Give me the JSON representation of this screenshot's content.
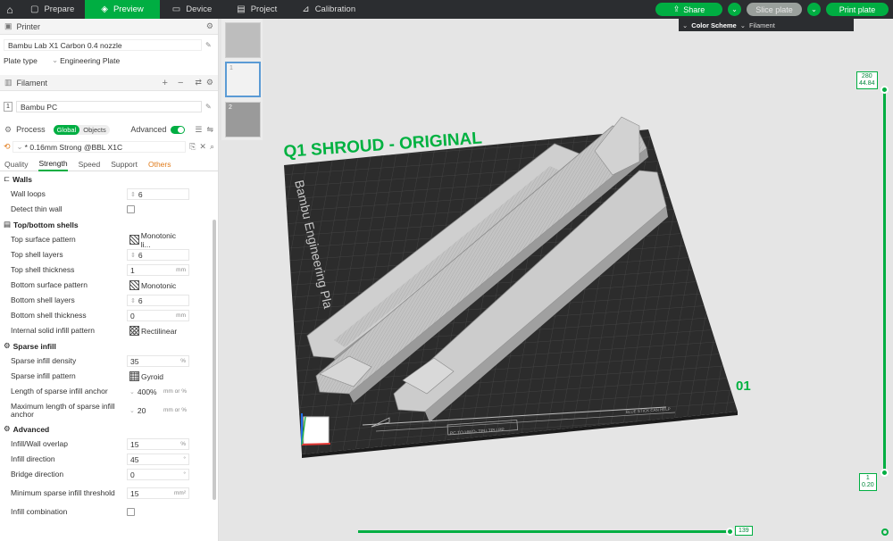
{
  "topbar": {
    "tabs": [
      {
        "label": "Prepare",
        "active": false
      },
      {
        "label": "Preview",
        "active": true
      },
      {
        "label": "Device",
        "active": false
      },
      {
        "label": "Project",
        "active": false
      },
      {
        "label": "Calibration",
        "active": false
      }
    ],
    "share": "Share",
    "slice_plate": "Slice plate",
    "print_plate": "Print plate"
  },
  "printer": {
    "title": "Printer",
    "name": "Bambu Lab X1 Carbon 0.4 nozzle",
    "plate_type_label": "Plate type",
    "plate_type": "Engineering Plate"
  },
  "filament": {
    "title": "Filament",
    "slot": "1",
    "name": "Bambu PC"
  },
  "process": {
    "title": "Process",
    "scope": [
      "Global",
      "Objects"
    ],
    "advanced_label": "Advanced",
    "preset": "* 0.16mm Strong @BBL X1C",
    "tabs": [
      "Quality",
      "Strength",
      "Speed",
      "Support",
      "Others"
    ],
    "active_tab": "Strength"
  },
  "settings": {
    "walls": {
      "title": "Walls",
      "wall_loops_label": "Wall loops",
      "wall_loops": "6",
      "detect_thin_wall_label": "Detect thin wall"
    },
    "shells": {
      "title": "Top/bottom shells",
      "top_pattern_label": "Top surface pattern",
      "top_pattern": "Monotonic li...",
      "top_layers_label": "Top shell layers",
      "top_layers": "6",
      "top_thickness_label": "Top shell thickness",
      "top_thickness": "1",
      "top_thickness_unit": "mm",
      "bottom_pattern_label": "Bottom surface pattern",
      "bottom_pattern": "Monotonic",
      "bottom_layers_label": "Bottom shell layers",
      "bottom_layers": "6",
      "bottom_thickness_label": "Bottom shell thickness",
      "bottom_thickness": "0",
      "bottom_thickness_unit": "mm",
      "internal_pattern_label": "Internal solid infill pattern",
      "internal_pattern": "Rectilinear"
    },
    "sparse": {
      "title": "Sparse infill",
      "density_label": "Sparse infill density",
      "density": "35",
      "density_unit": "%",
      "pattern_label": "Sparse infill pattern",
      "pattern": "Gyroid",
      "anchor_label": "Length of sparse infill anchor",
      "anchor": "400%",
      "anchor_unit": "mm or %",
      "max_anchor_label": "Maximum length of sparse infill anchor",
      "max_anchor": "20",
      "max_anchor_unit": "mm or %"
    },
    "advanced": {
      "title": "Advanced",
      "overlap_label": "Infill/Wall overlap",
      "overlap": "15",
      "overlap_unit": "%",
      "direction_label": "Infill direction",
      "direction": "45",
      "direction_unit": "°",
      "bridge_label": "Bridge direction",
      "bridge": "0",
      "bridge_unit": "°",
      "min_area_label": "Minimum sparse infill threshold",
      "min_area": "15",
      "min_area_unit": "mm²",
      "combination_label": "Infill combination"
    }
  },
  "viewport": {
    "color_scheme_label": "Color Scheme",
    "color_scheme": "Filament",
    "thumbs": [
      "1",
      "2"
    ],
    "plate_texts": {
      "title": "Q1 SHROUD - ORIGINAL",
      "side": "Bambu Engineering Pla",
      "plate_number": "01",
      "brand": "BLUE STICK CAN HELP",
      "box": "PC TO HWO- TPU TPU PP"
    },
    "layer_top": "280",
    "layer_top_height": "44.84",
    "layer_bottom": "1",
    "layer_bottom_height": "0.20",
    "move_value": "139"
  },
  "colors": {
    "accent": "#00ae42",
    "topbar": "#2b2d30",
    "bed": "#2c2c2c",
    "model": "#c8c8c8"
  }
}
